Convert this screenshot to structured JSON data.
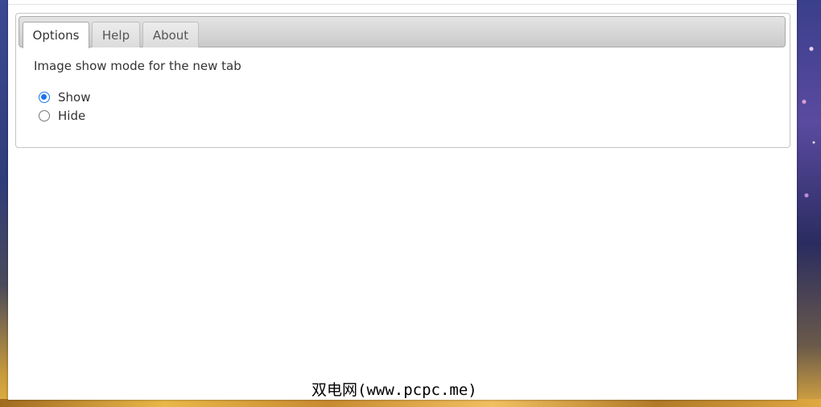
{
  "tabs": [
    {
      "label": "Options",
      "active": true
    },
    {
      "label": "Help",
      "active": false
    },
    {
      "label": "About",
      "active": false
    }
  ],
  "options": {
    "section_label": "Image show mode for the new tab",
    "radios": [
      {
        "label": "Show",
        "checked": true
      },
      {
        "label": "Hide",
        "checked": false
      }
    ]
  },
  "watermark": "双电网(www.pcpc.me)",
  "colors": {
    "accent": "#1a73e8",
    "text": "#333333",
    "tab_inactive_text": "#555555"
  }
}
